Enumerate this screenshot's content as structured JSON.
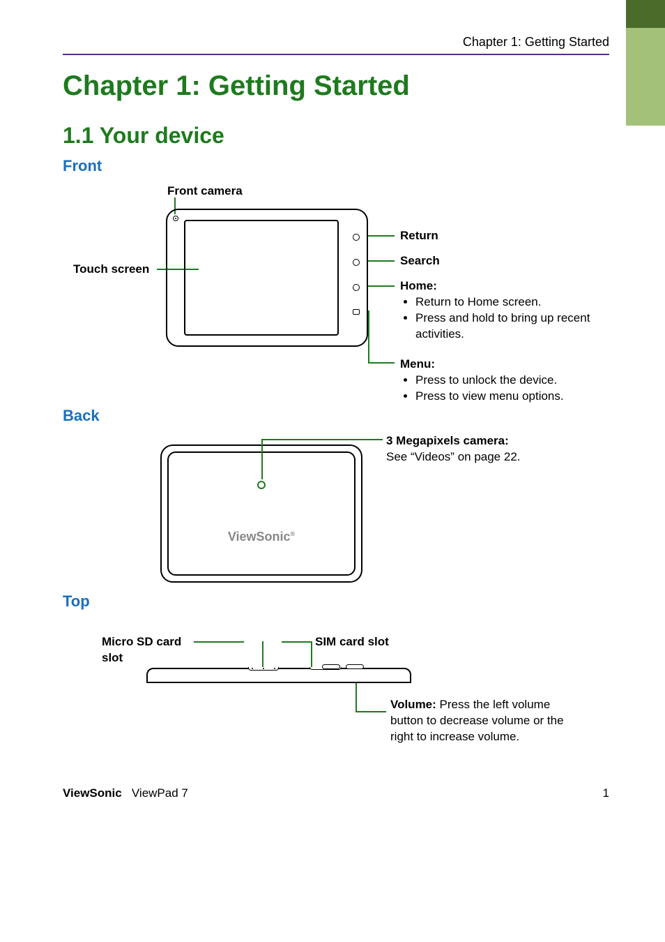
{
  "header": {
    "chapter_ref": "Chapter 1: Getting Started"
  },
  "chapter_title": "Chapter 1: Getting Started",
  "section_title": "1.1 Your device",
  "front": {
    "heading": "Front",
    "labels": {
      "front_camera": "Front camera",
      "touch_screen": "Touch screen",
      "return": "Return",
      "search": "Search",
      "home_title": "Home:",
      "home_items": [
        "Return to Home screen.",
        "Press and hold to bring up recent activities."
      ],
      "menu_title": "Menu:",
      "menu_items": [
        "Press to unlock the device.",
        "Press to view menu options."
      ]
    }
  },
  "back": {
    "heading": "Back",
    "labels": {
      "camera_title": "3 Megapixels camera:",
      "camera_desc": "See “Videos” on page 22."
    },
    "logo": "ViewSonic"
  },
  "top": {
    "heading": "Top",
    "labels": {
      "micro_sd": "Micro SD card slot",
      "sim": "SIM card slot",
      "volume_title": "Volume: ",
      "volume_desc": "Press the left volume button to decrease volume or the right to increase volume."
    }
  },
  "footer": {
    "brand": "ViewSonic",
    "product": "ViewPad 7",
    "page": "1"
  }
}
